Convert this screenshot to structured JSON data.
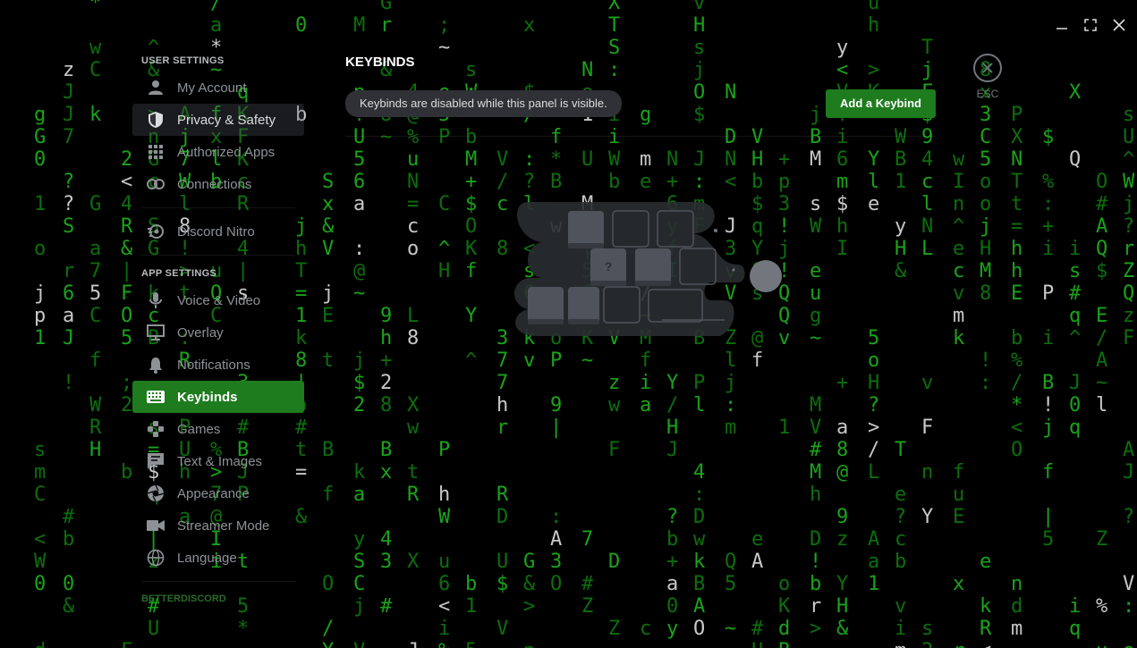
{
  "window_controls": {
    "minimize_icon": "minimize-icon",
    "maximize_icon": "maximize-icon",
    "close_icon": "close-icon"
  },
  "sidebar": {
    "user_settings_header": "USER SETTINGS",
    "user_items": [
      {
        "label": "My Account",
        "icon": "user-icon"
      },
      {
        "label": "Privacy & Safety",
        "icon": "shield-icon"
      },
      {
        "label": "Authorized Apps",
        "icon": "grid-icon"
      },
      {
        "label": "Connections",
        "icon": "link-icon"
      }
    ],
    "nitro_item": {
      "label": "Discord Nitro",
      "icon": "nitro-icon"
    },
    "app_settings_header": "APP SETTINGS",
    "app_items": [
      {
        "label": "Voice & Video",
        "icon": "microphone-icon"
      },
      {
        "label": "Overlay",
        "icon": "monitor-icon"
      },
      {
        "label": "Notifications",
        "icon": "bell-icon"
      },
      {
        "label": "Keybinds",
        "icon": "keyboard-icon"
      },
      {
        "label": "Games",
        "icon": "gamepad-icon"
      },
      {
        "label": "Text & Images",
        "icon": "message-icon"
      },
      {
        "label": "Appearance",
        "icon": "palette-icon"
      },
      {
        "label": "Streamer Mode",
        "icon": "camera-icon"
      },
      {
        "label": "Language",
        "icon": "globe-icon"
      }
    ],
    "betterdiscord_header": "BETTERDISCORD"
  },
  "content": {
    "title": "KEYBINDS",
    "notice": "Keybinds are disabled while this panel is visible.",
    "add_button": "Add a Keybind",
    "illustration": "keyboard-keys-illustration"
  },
  "close": {
    "icon": "close-circle-icon",
    "label": "ESC"
  },
  "colors": {
    "accent": "#1e7b1e",
    "background": "#000000",
    "matrix_green": "#1aa31a"
  }
}
